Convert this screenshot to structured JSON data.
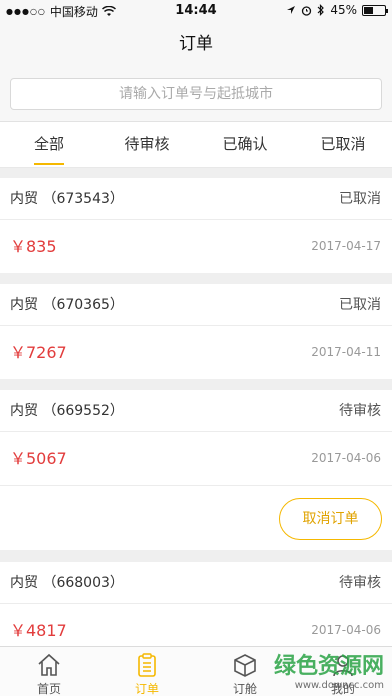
{
  "status_bar": {
    "carrier": "中国移动",
    "time": "14:44",
    "battery": "45%",
    "battery_level": 0.45
  },
  "nav": {
    "title": "订单"
  },
  "search": {
    "placeholder": "请输入订单号与起抵城市"
  },
  "tabs": [
    {
      "label": "全部",
      "active": true
    },
    {
      "label": "待审核",
      "active": false
    },
    {
      "label": "已确认",
      "active": false
    },
    {
      "label": "已取消",
      "active": false
    }
  ],
  "orders": [
    {
      "title": "内贸 （673543）",
      "status": "已取消",
      "price": "￥835",
      "date": "2017-04-17"
    },
    {
      "title": "内贸 （670365）",
      "status": "已取消",
      "price": "￥7267",
      "date": "2017-04-11"
    },
    {
      "title": "内贸 （669552）",
      "status": "待审核",
      "price": "￥5067",
      "date": "2017-04-06",
      "action": "取消订单"
    },
    {
      "title": "内贸 （668003）",
      "status": "待审核",
      "price": "￥4817",
      "date": "2017-04-06"
    }
  ],
  "tabbar": [
    {
      "label": "首页",
      "icon": "home-icon",
      "active": false
    },
    {
      "label": "订单",
      "icon": "clipboard-icon",
      "active": true
    },
    {
      "label": "订舱",
      "icon": "box-icon",
      "active": false
    },
    {
      "label": "我的",
      "icon": "person-icon",
      "active": false
    }
  ],
  "watermark": {
    "text": "绿色资源网",
    "url": "www.downcc.com"
  },
  "colors": {
    "accent": "#f5b800",
    "price": "#e23c3c"
  }
}
